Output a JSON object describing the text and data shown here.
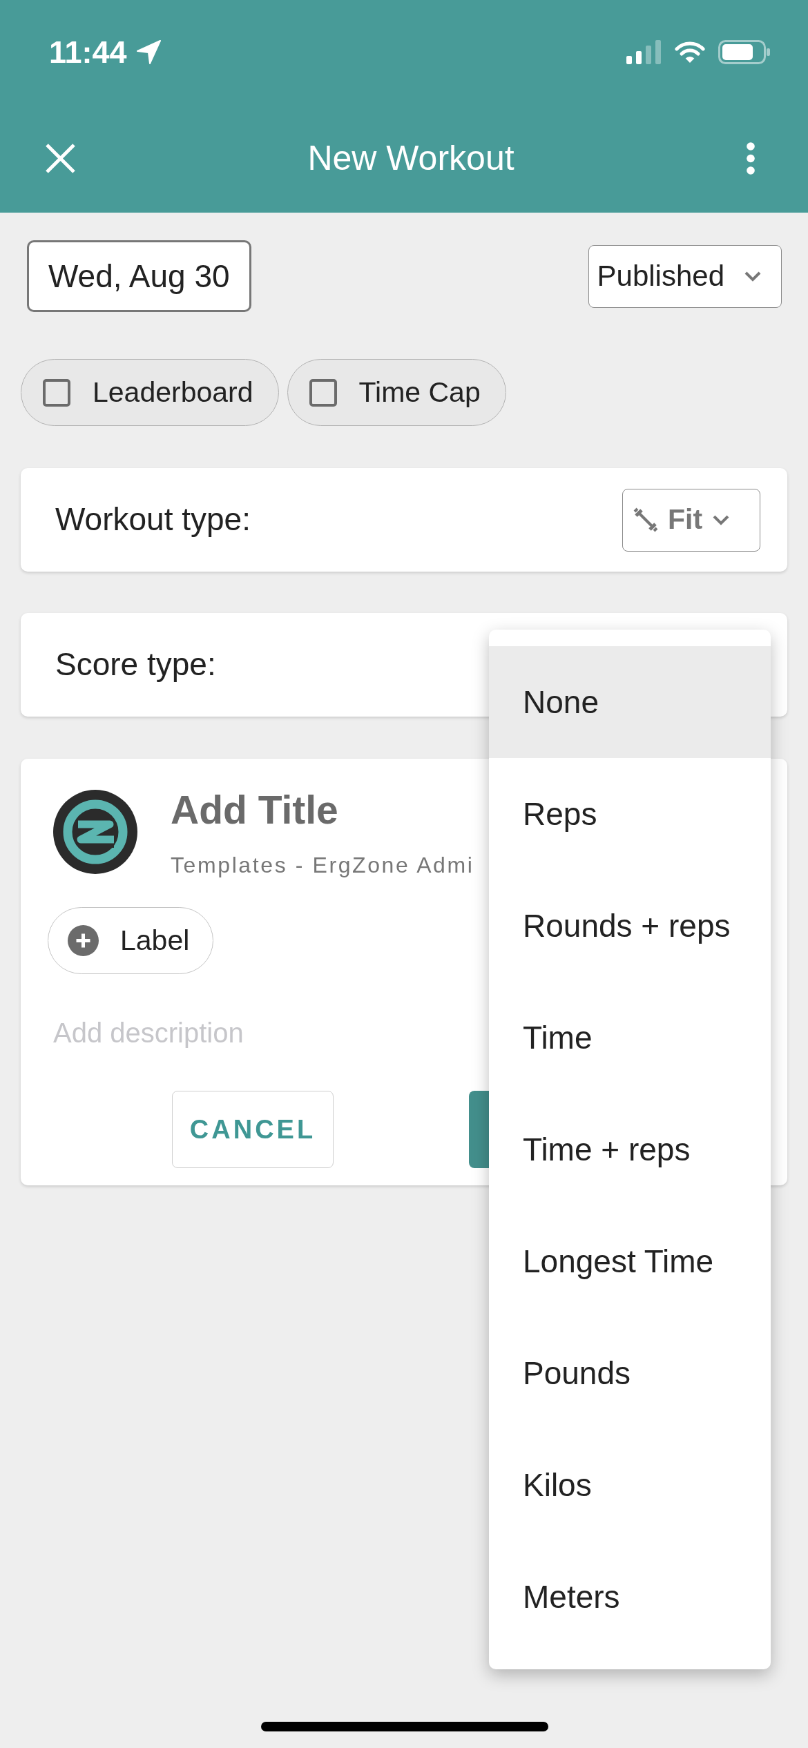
{
  "status_bar": {
    "time": "11:44"
  },
  "header": {
    "title": "New Workout"
  },
  "date_button": {
    "label": "Wed, Aug 30"
  },
  "publish_select": {
    "value": "Published"
  },
  "toggles": [
    {
      "label": "Leaderboard",
      "checked": false
    },
    {
      "label": "Time Cap",
      "checked": false
    }
  ],
  "workout_type": {
    "label": "Workout type:",
    "value": "Fit"
  },
  "score_type": {
    "label": "Score type:"
  },
  "workout_card": {
    "title": "Add Title",
    "subtitle": "Templates - ErgZone Admi",
    "label_button": "Label",
    "description": {
      "placeholder": "Add description"
    },
    "buttons": [
      {
        "kind": "outline",
        "label": "CANCEL"
      },
      {
        "kind": "filled"
      }
    ]
  },
  "score_menu": {
    "options": [
      {
        "label": "None",
        "selected": true
      },
      {
        "label": "Reps",
        "selected": false
      },
      {
        "label": "Rounds + reps",
        "selected": false
      },
      {
        "label": "Time",
        "selected": false
      },
      {
        "label": "Time + reps",
        "selected": false
      },
      {
        "label": "Longest Time",
        "selected": false
      },
      {
        "label": "Pounds",
        "selected": false
      },
      {
        "label": "Kilos",
        "selected": false
      },
      {
        "label": "Meters",
        "selected": false
      }
    ]
  }
}
